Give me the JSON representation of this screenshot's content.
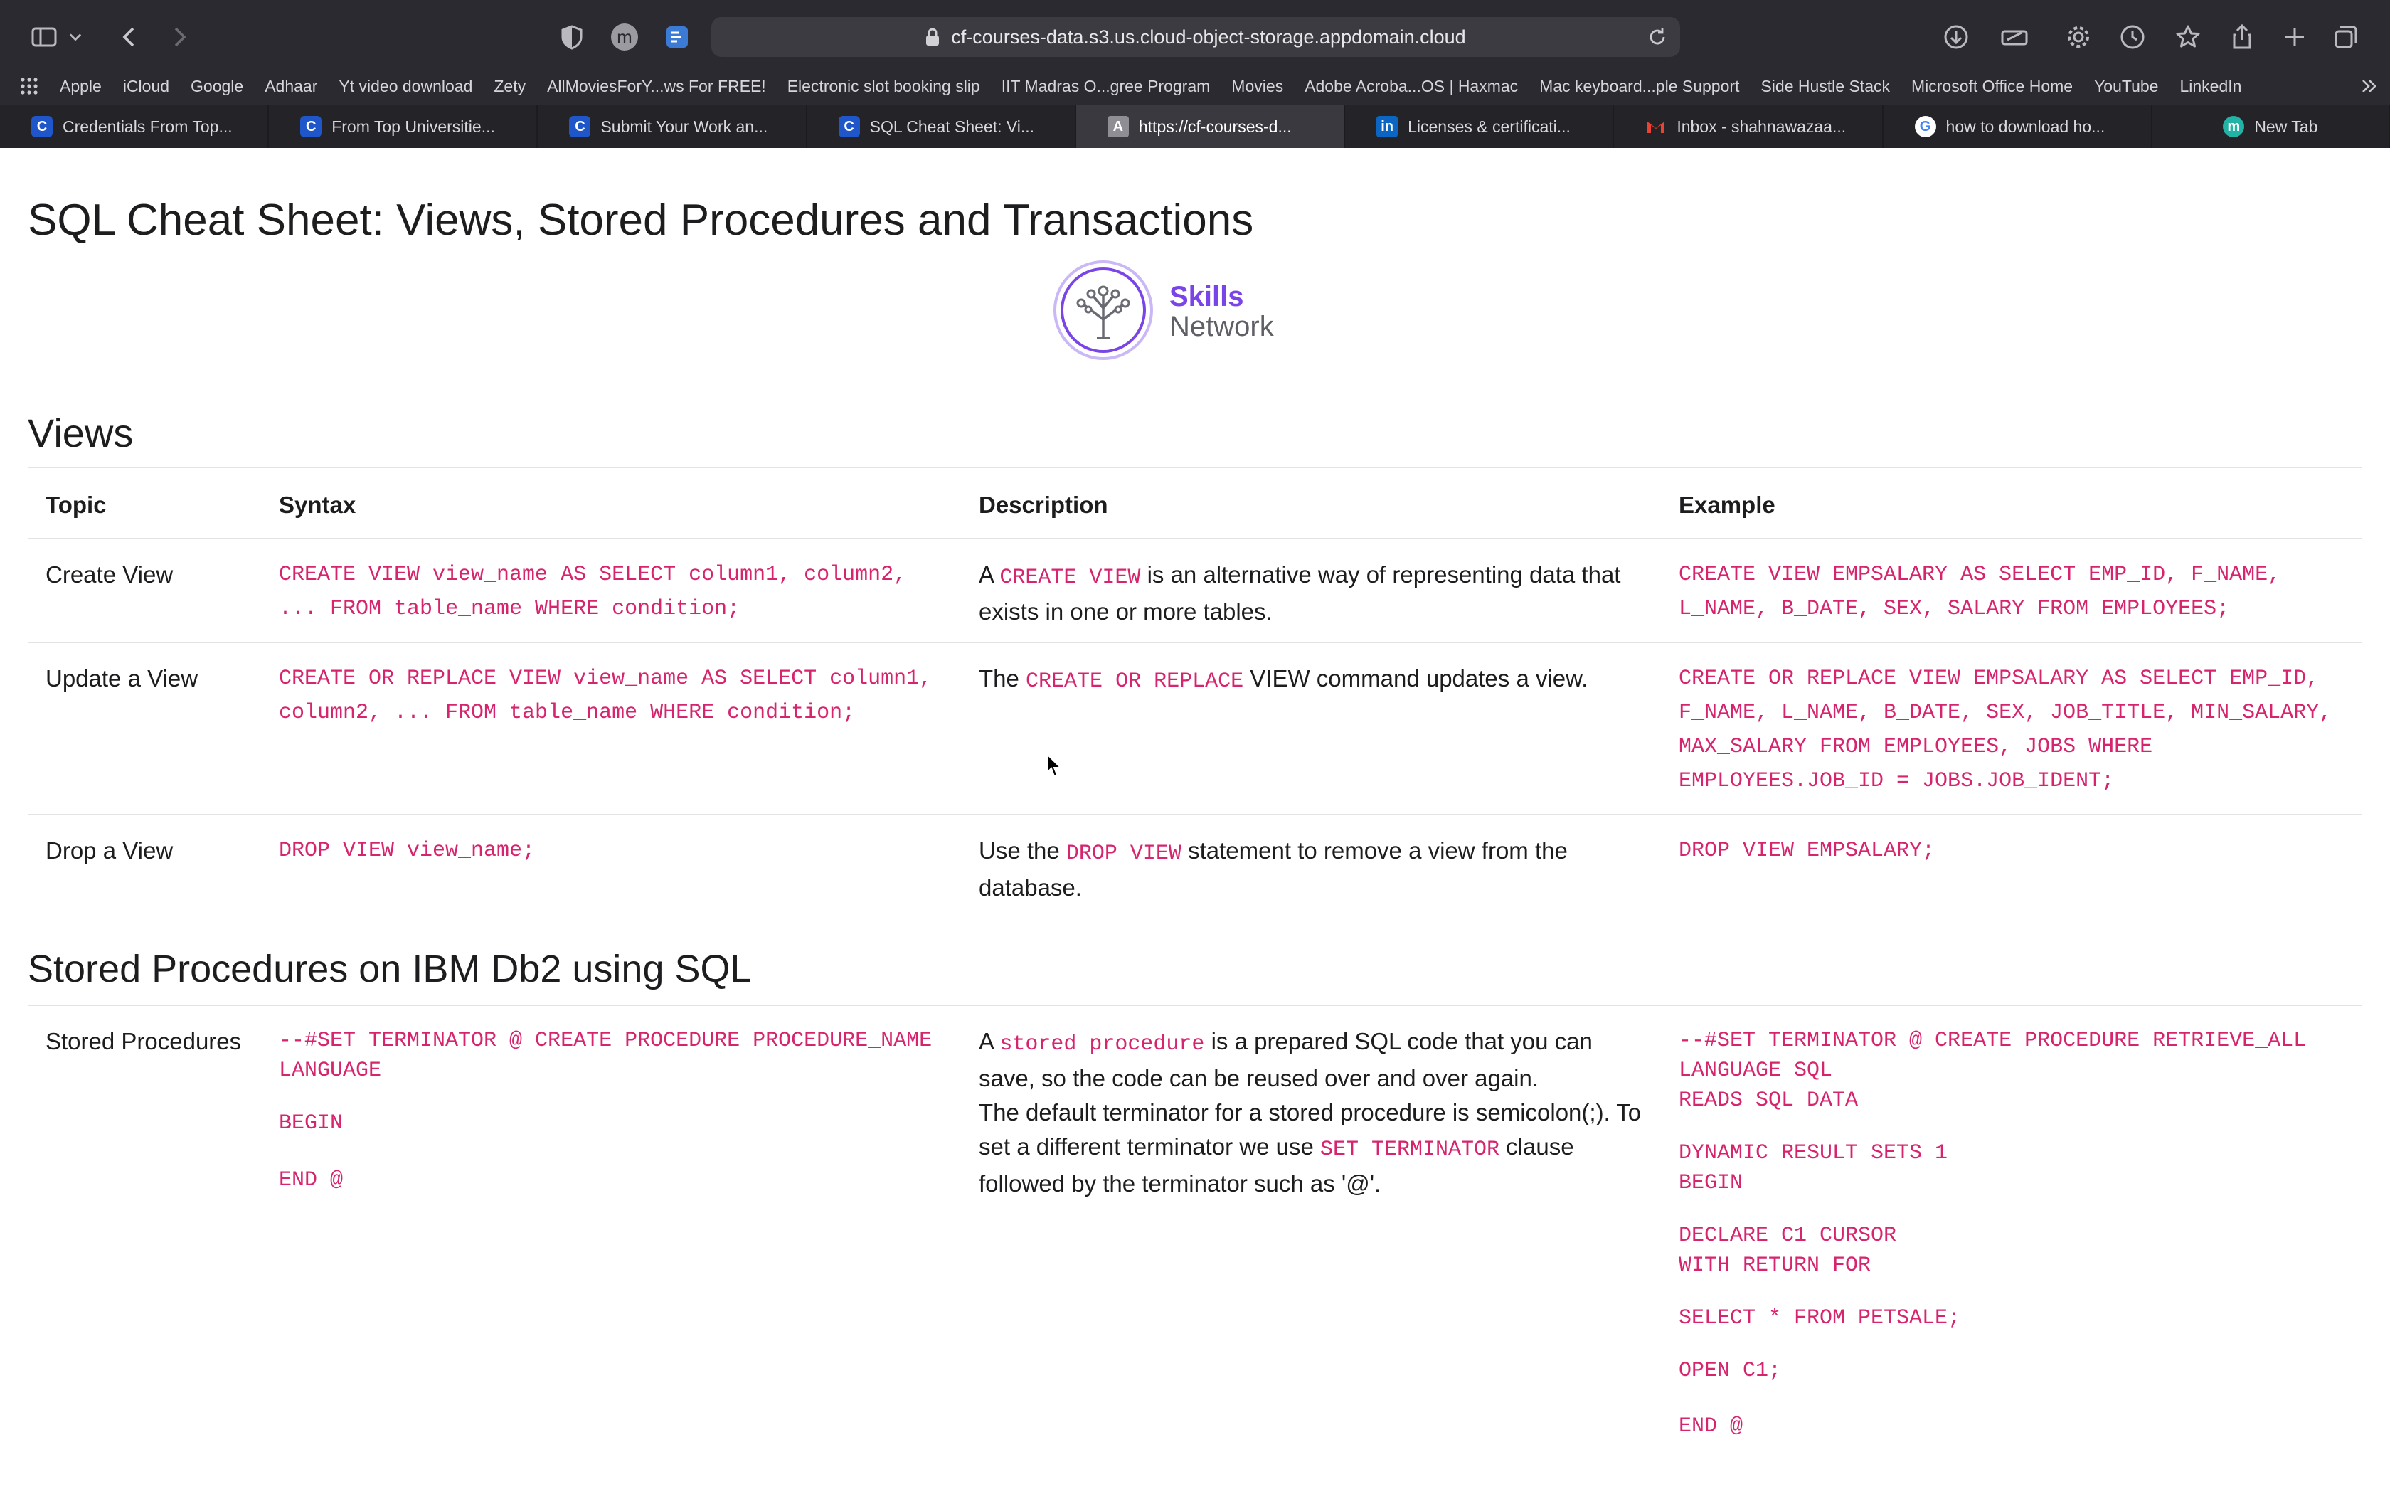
{
  "browser": {
    "url": "cf-courses-data.s3.us.cloud-object-storage.appdomain.cloud",
    "bookmarks": [
      "Apple",
      "iCloud",
      "Google",
      "Adhaar",
      "Yt video download",
      "Zety",
      "AllMoviesForY...ws For FREE!",
      "Electronic slot booking slip",
      "IIT Madras O...gree Program",
      "Movies",
      "Adobe Acroba...OS | Haxmac",
      "Mac keyboard...ple Support",
      "Side Hustle Stack",
      "Microsoft Office Home",
      "YouTube",
      "LinkedIn"
    ],
    "tabs": [
      {
        "label": "Credentials From Top...",
        "icon": "coursera-icon"
      },
      {
        "label": "From Top Universitie...",
        "icon": "coursera-icon"
      },
      {
        "label": "Submit Your Work an...",
        "icon": "coursera-icon"
      },
      {
        "label": "SQL Cheat Sheet: Vi...",
        "icon": "coursera-icon"
      },
      {
        "label": "https://cf-courses-d...",
        "icon": "generic-page-icon"
      },
      {
        "label": "Licenses & certificati...",
        "icon": "linkedin-icon"
      },
      {
        "label": "Inbox - shahnawazaa...",
        "icon": "gmail-icon"
      },
      {
        "label": "how to download ho...",
        "icon": "google-icon"
      },
      {
        "label": "New Tab",
        "icon": "new-tab-icon"
      }
    ],
    "avatar_letter": "m",
    "new_tab_avatar_letter": "m",
    "colors": {
      "chrome": "#2b2a30",
      "active_tab": "#3a3940",
      "code": "#d6246e",
      "logo_purple": "#7a45e6"
    }
  },
  "page": {
    "title": "SQL Cheat Sheet: Views, Stored Procedures and Transactions",
    "logo": {
      "line1": "Skills",
      "line2": "Network"
    },
    "views": {
      "heading": "Views",
      "headers": {
        "topic": "Topic",
        "syntax": "Syntax",
        "description": "Description",
        "example": "Example"
      },
      "rows": [
        {
          "topic": "Create View",
          "syntax": "CREATE VIEW view_name AS SELECT column1, column2, ... FROM table_name WHERE condition;",
          "desc_pre": "A ",
          "desc_code": "CREATE VIEW",
          "desc_post": " is an alternative way of representing data that exists in one or more tables.",
          "example": "CREATE VIEW EMPSALARY AS SELECT EMP_ID, F_NAME, L_NAME, B_DATE, SEX, SALARY FROM EMPLOYEES;"
        },
        {
          "topic": "Update a View",
          "syntax": "CREATE OR REPLACE VIEW view_name AS SELECT column1, column2, ... FROM table_name WHERE condition;",
          "desc_pre": "The ",
          "desc_code": "CREATE OR REPLACE",
          "desc_post": " VIEW command updates a view.",
          "example": "CREATE OR REPLACE VIEW EMPSALARY AS SELECT EMP_ID, F_NAME, L_NAME, B_DATE, SEX, JOB_TITLE, MIN_SALARY, MAX_SALARY FROM EMPLOYEES, JOBS WHERE EMPLOYEES.JOB_ID = JOBS.JOB_IDENT;"
        },
        {
          "topic": "Drop a View",
          "syntax": "DROP VIEW view_name;",
          "desc_pre": "Use the ",
          "desc_code": "DROP VIEW",
          "desc_post": " statement to remove a view from the database.",
          "example": "DROP VIEW EMPSALARY;"
        }
      ]
    },
    "stored_procedures": {
      "heading": "Stored Procedures on IBM Db2 using SQL",
      "topic": "Stored Procedures",
      "syntax_line1": "--#SET TERMINATOR @ CREATE PROCEDURE PROCEDURE_NAME",
      "syntax_line2": "LANGUAGE",
      "syntax_begin": "BEGIN",
      "syntax_end": "END @",
      "desc_pre": "A ",
      "desc_code": "stored procedure",
      "desc_post": " is a prepared SQL code that you can save, so the code can be reused over and over again.",
      "desc2_pre": "The default terminator for a stored procedure is semicolon(;). To set a different terminator we use ",
      "desc2_code": "SET TERMINATOR",
      "desc2_post": " clause followed by the terminator such as '@'.",
      "example_lines": [
        "--#SET TERMINATOR @ CREATE PROCEDURE RETRIEVE_ALL",
        "LANGUAGE SQL",
        "READS SQL DATA",
        "DYNAMIC RESULT SETS 1",
        "BEGIN",
        "DECLARE C1 CURSOR",
        "WITH RETURN FOR",
        "SELECT * FROM PETSALE;",
        "OPEN C1;",
        "END @"
      ]
    }
  }
}
